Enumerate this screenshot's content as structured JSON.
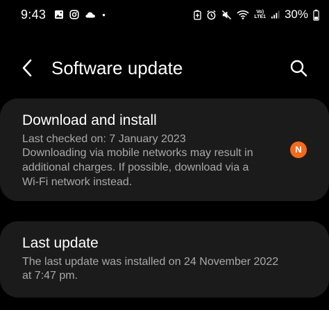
{
  "status_bar": {
    "time": "9:43",
    "network_label_top": "Vo)",
    "network_label_bottom": "LTE1",
    "battery": "30%",
    "left_icons": [
      "gallery-icon",
      "instagram-icon",
      "cloud-icon",
      "dot-icon"
    ],
    "right_icons": [
      "battery-saver-icon",
      "alarm-icon",
      "mute-icon",
      "wifi-icon",
      "volte-icon",
      "signal-icon",
      "battery-icon"
    ]
  },
  "header": {
    "title": "Software update",
    "back_icon": "back-chevron-icon",
    "search_icon": "search-icon"
  },
  "download_card": {
    "title": "Download and install",
    "last_checked": "Last checked on: 7 January 2023",
    "notice_line1": "Downloading via mobile networks may result in",
    "notice_line2": "additional charges. If possible, download via a",
    "notice_line3": "Wi-Fi network instead.",
    "badge": "N",
    "badge_color": "#f46a1c"
  },
  "last_update_card": {
    "title": "Last update",
    "line1": "The last update was installed on 24 November 2022",
    "line2": "at 7:47 pm."
  },
  "colors": {
    "background": "#000000",
    "card": "#1b1b1b",
    "primary_text": "#ffffff",
    "secondary_text": "#a9a9a9"
  }
}
